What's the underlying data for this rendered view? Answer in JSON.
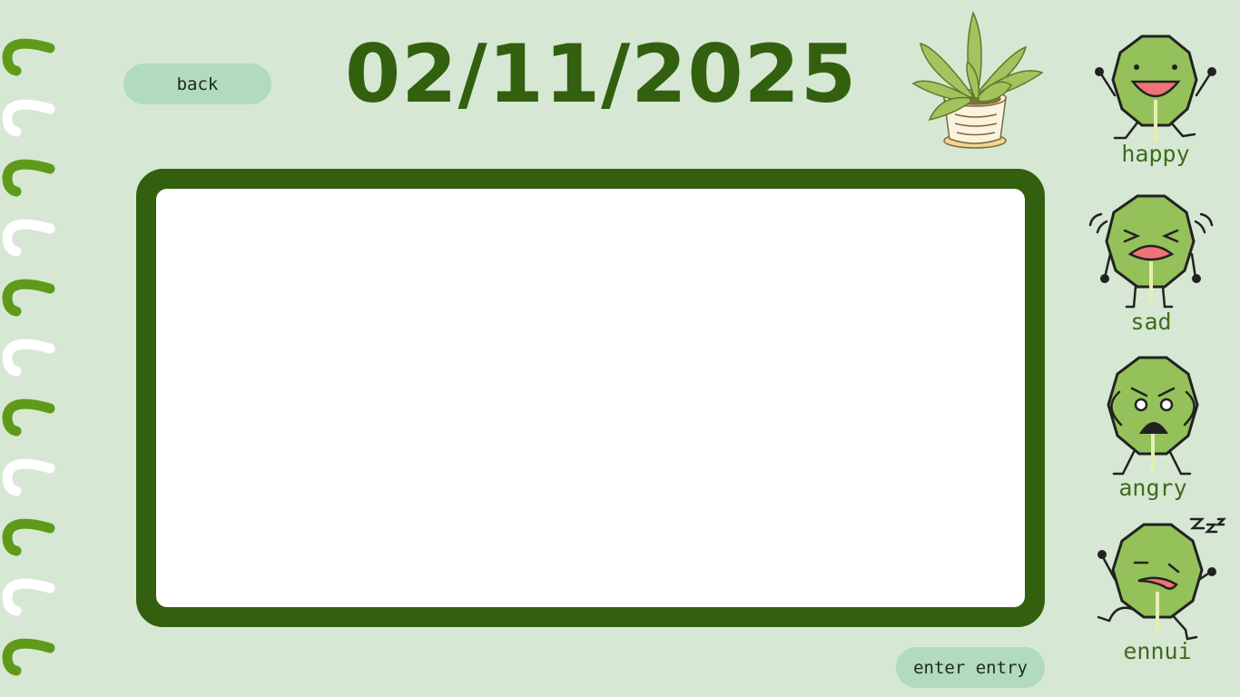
{
  "header": {
    "date": "02/11/2025",
    "back_label": "back"
  },
  "entry": {
    "value": "",
    "submit_label": "enter entry"
  },
  "moods": [
    {
      "key": "happy",
      "label": "happy",
      "icon": "happy-leaf-icon"
    },
    {
      "key": "sad",
      "label": "sad",
      "icon": "sad-leaf-icon"
    },
    {
      "key": "angry",
      "label": "angry",
      "icon": "angry-leaf-icon"
    },
    {
      "key": "ennui",
      "label": "ennui",
      "icon": "sleepy-leaf-icon"
    }
  ],
  "decor": {
    "plant_icon": "potted-plant-icon",
    "binding_icon": "spiral-binding-icon"
  },
  "colors": {
    "background": "#d6e8d4",
    "accent_dark_green": "#33600f",
    "button_green": "#b2dbbd",
    "leaf_green": "#95c15a",
    "mouth_pink": "#ee7474"
  }
}
